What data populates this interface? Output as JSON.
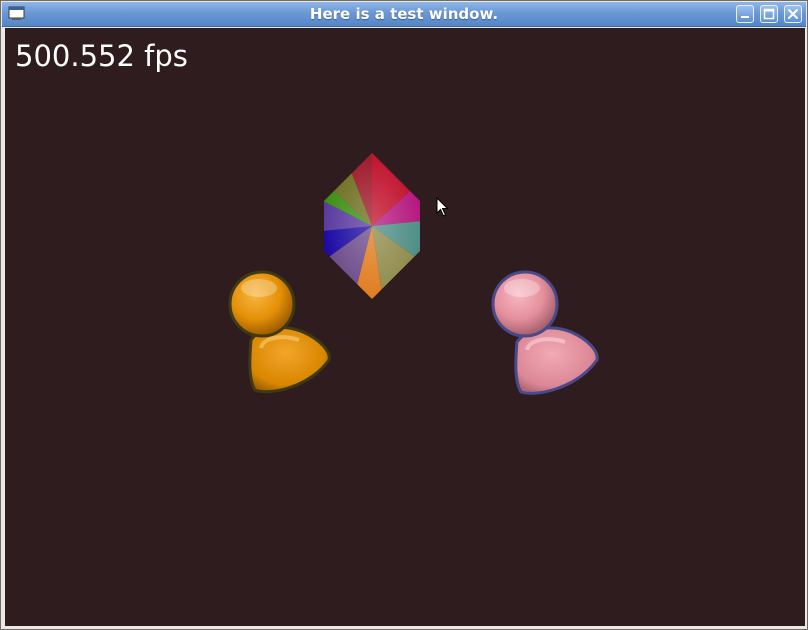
{
  "window": {
    "title": "Here is a test window."
  },
  "scene": {
    "fps_text": "500.552 fps",
    "background_color": "#2f1c1f",
    "sprites": [
      {
        "name": "gem-icon",
        "colors": [
          "#c1002a",
          "#c51b85",
          "#3d8f14",
          "#1c0aa3",
          "#e27d1f"
        ]
      },
      {
        "name": "buddy-orange-icon",
        "color": "#e48f07"
      },
      {
        "name": "buddy-pink-icon",
        "color": "#e48f9c"
      }
    ]
  },
  "icons": {
    "window_menu": "window-menu-icon",
    "minimize": "minimize-icon",
    "maximize": "maximize-icon",
    "close": "close-icon",
    "cursor": "mouse-pointer-icon"
  }
}
